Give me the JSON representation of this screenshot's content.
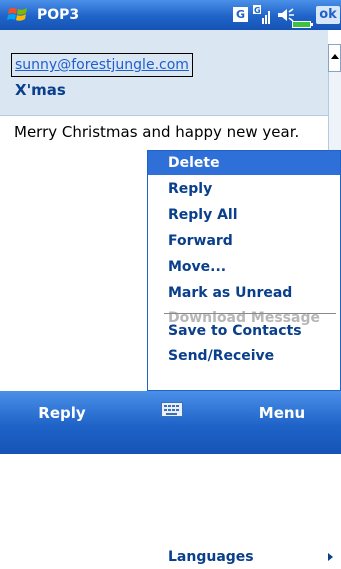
{
  "title_bar": {
    "app_title": "POP3",
    "g_indicator": "G",
    "ok_label": "ok",
    "icons": [
      "windows-start-icon",
      "gprs-g-icon",
      "signal-strength-icon",
      "speaker-icon",
      "battery-icon"
    ]
  },
  "message": {
    "from": "sunny@forestjungle.com",
    "subject": "X'mas",
    "body": "Merry Christmas and happy new year."
  },
  "context_menu": {
    "items": [
      {
        "label": "Delete",
        "state": "selected"
      },
      {
        "label": "Reply",
        "state": "normal"
      },
      {
        "label": "Reply All",
        "state": "normal"
      },
      {
        "label": "Forward",
        "state": "normal"
      },
      {
        "label": "Move...",
        "state": "normal"
      },
      {
        "label": "Mark as Unread",
        "state": "normal"
      },
      {
        "label": "Download Message",
        "state": "disabled"
      },
      {
        "label": "Save to Contacts",
        "state": "normal"
      },
      {
        "label": "Send/Receive",
        "state": "normal"
      },
      {
        "label": "Languages",
        "state": "normal",
        "has_submenu": true
      }
    ]
  },
  "softkeys": {
    "left": "Reply",
    "right": "Menu",
    "center_icon": "keyboard-icon"
  },
  "colors": {
    "titlebar_blue": "#1f63c8",
    "header_bg": "#dbe6f3",
    "selection_blue": "#2f6fd8",
    "menu_text": "#0a3f8c",
    "disabled_text": "#b7b7b7"
  }
}
